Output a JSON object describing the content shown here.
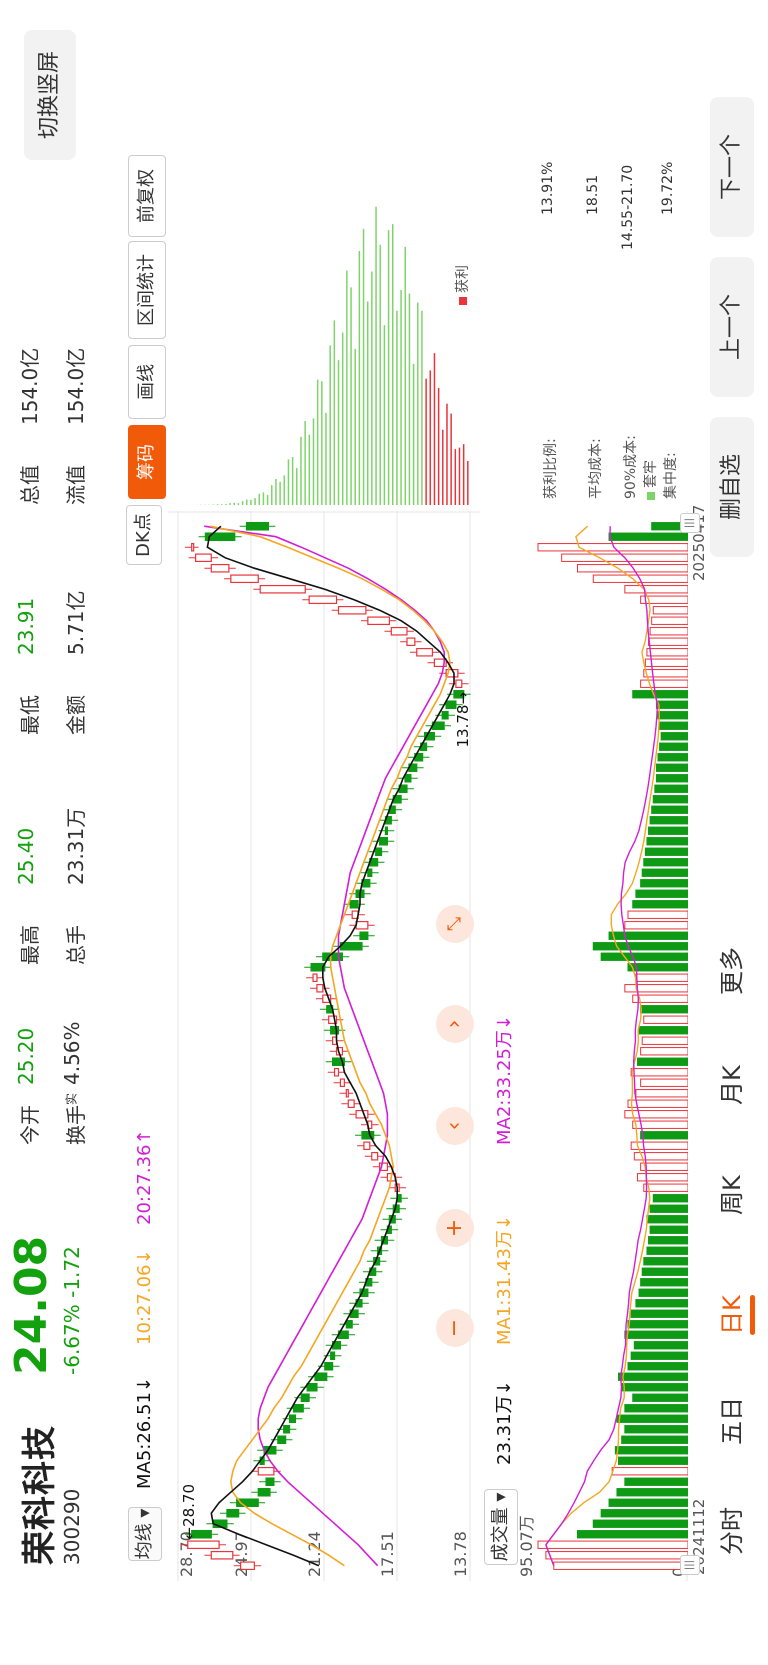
{
  "stock": {
    "name": "荣科科技",
    "code": "300290",
    "price": "24.08",
    "change": "-6.67%  -1.72"
  },
  "quote": [
    {
      "label": "今开",
      "value": "25.20",
      "green": true
    },
    {
      "label": "最高",
      "value": "25.40",
      "green": true
    },
    {
      "label": "最低",
      "value": "23.91",
      "green": true
    },
    {
      "label": "总值",
      "value": "154.0亿",
      "green": false
    },
    {
      "label": "换手",
      "value": "4.56%",
      "green": false
    },
    {
      "label": "总手",
      "value": "23.31万",
      "green": false
    },
    {
      "label": "金额",
      "value": "5.71亿",
      "green": false
    },
    {
      "label": "流值",
      "value": "154.0亿",
      "green": false
    }
  ],
  "turnover_sup": "实",
  "switch_label": "切换竖屏",
  "toolbar": {
    "ma_select": "均线",
    "ma5": "MA5:26.51↓",
    "ma10": "10:27.06↓",
    "ma20": "20:27.36↑",
    "dk": "DK点",
    "tabs": [
      "筹码",
      "画线",
      "区间统计",
      "前复权"
    ]
  },
  "volume": {
    "select": "成交量",
    "vol": "23.31万↓",
    "ma1": "MA1:31.43万↓",
    "ma2": "MA2:33.25万↓",
    "max_label": "95.07万",
    "zero_label": "0"
  },
  "dates": {
    "start": "20241112",
    "end": "20250417"
  },
  "price_axis": {
    "top": "28.70",
    "l2": "24.97",
    "l3": "21.24",
    "l4": "17.51",
    "bottom": "13.78"
  },
  "markers": {
    "high": "←28.70",
    "low": "13.78→"
  },
  "chips": {
    "legend_hold": "套牢",
    "legend_profit": "获利",
    "profit_ratio_label": "获利比例:",
    "profit_ratio": "13.91%",
    "avg_cost_label": "平均成本:",
    "avg_cost": "18.51",
    "cost90_label": "90%成本:",
    "cost90": "14.55-21.70",
    "concentration_label": "集中度:",
    "concentration": "19.72%"
  },
  "bottom_tabs": [
    "分时",
    "五日",
    "日K",
    "周K",
    "月K",
    "更多"
  ],
  "active_tab": 2,
  "nav": {
    "delete": "删自选",
    "prev": "上一个",
    "next": "下一个"
  },
  "colors": {
    "up": "#e8343a",
    "down": "#0e9a14",
    "ma5": "#111111",
    "ma10": "#f5a623",
    "ma20": "#d21ed7",
    "accent": "#f15a09",
    "price_green": "#13a10e"
  },
  "chart_data": {
    "type": "candlestick",
    "x_start": "20241112",
    "x_end": "20250417",
    "ylim": [
      13.78,
      28.7
    ],
    "close": [
      25.5,
      27.0,
      28.2,
      27.0,
      26.2,
      25.6,
      24.6,
      24.0,
      23.8,
      24.6,
      24.3,
      23.7,
      23.2,
      23.0,
      22.7,
      22.3,
      22.0,
      21.6,
      21.1,
      20.8,
      20.7,
      20.4,
      20.0,
      19.8,
      19.5,
      19.3,
      19.0,
      18.8,
      18.6,
      18.4,
      18.3,
      18.0,
      17.8,
      17.6,
      17.4,
      17.3,
      17.6,
      18.0,
      18.4,
      18.8,
      19.2,
      18.7,
      19.0,
      19.6,
      20.0,
      20.1,
      20.4,
      20.7,
      20.2,
      20.6,
      20.8,
      20.5,
      21.0,
      20.8,
      21.3,
      21.6,
      21.8,
      21.2,
      20.3,
      19.3,
      19.0,
      19.6,
      19.8,
      19.5,
      19.2,
      18.9,
      18.8,
      18.5,
      18.3,
      18.0,
      18.0,
      17.8,
      17.6,
      17.3,
      17.0,
      16.8,
      16.5,
      16.2,
      16.0,
      15.6,
      15.1,
      14.9,
      14.5,
      14.1,
      14.5,
      15.0,
      15.6,
      16.5,
      17.0,
      17.8,
      19.0,
      20.5,
      22.0,
      24.5,
      26.0,
      27.0,
      27.8,
      28.0,
      25.8,
      24.08
    ],
    "open": [
      24.8,
      25.9,
      26.6,
      28.0,
      26.9,
      26.2,
      25.7,
      24.6,
      24.2,
      23.8,
      24.5,
      24.3,
      23.6,
      23.3,
      23.0,
      22.8,
      22.4,
      22.1,
      21.7,
      21.2,
      20.9,
      20.8,
      20.5,
      20.1,
      19.9,
      19.6,
      19.4,
      19.1,
      18.9,
      18.7,
      18.5,
      18.3,
      18.0,
      17.9,
      17.7,
      17.5,
      17.4,
      17.6,
      18.0,
      18.5,
      18.9,
      19.3,
      18.8,
      19.0,
      19.7,
      20.1,
      20.2,
      20.5,
      20.8,
      20.3,
      20.6,
      20.9,
      20.6,
      21.1,
      20.9,
      21.3,
      21.6,
      21.9,
      21.3,
      20.4,
      19.4,
      19.0,
      19.5,
      19.9,
      19.6,
      19.3,
      19.0,
      18.9,
      18.6,
      18.4,
      18.1,
      18.1,
      17.9,
      17.7,
      17.4,
      17.1,
      16.9,
      16.6,
      16.3,
      16.1,
      15.7,
      15.2,
      15.0,
      14.6,
      14.2,
      14.4,
      15.0,
      15.7,
      16.6,
      17.0,
      17.9,
      19.1,
      20.6,
      22.2,
      24.6,
      26.1,
      27.0,
      28.0,
      27.3,
      25.2
    ],
    "ma5": [
      21.5,
      22.8,
      24.2,
      25.6,
      26.9,
      27.0,
      26.6,
      26.0,
      25.4,
      24.9,
      24.5,
      24.1,
      23.8,
      23.5,
      23.2,
      22.9,
      22.6,
      22.2,
      21.8,
      21.4,
      21.1,
      20.8,
      20.5,
      20.2,
      19.9,
      19.6,
      19.3,
      19.1,
      18.9,
      18.6,
      18.4,
      18.2,
      18.0,
      17.8,
      17.6,
      17.5,
      17.5,
      17.6,
      17.8,
      18.1,
      18.6,
      18.9,
      19.0,
      19.2,
      19.4,
      19.6,
      19.9,
      20.2,
      20.3,
      20.5,
      20.6,
      20.6,
      20.7,
      20.8,
      21.0,
      21.2,
      21.3,
      21.3,
      21.0,
      20.4,
      19.9,
      19.6,
      19.5,
      19.4,
      19.4,
      19.3,
      19.1,
      18.9,
      18.7,
      18.5,
      18.3,
      18.1,
      17.9,
      17.7,
      17.4,
      17.2,
      16.9,
      16.6,
      16.3,
      16.0,
      15.7,
      15.4,
      15.1,
      14.8,
      14.6,
      14.6,
      14.9,
      15.3,
      15.9,
      16.5,
      17.3,
      18.4,
      19.7,
      21.2,
      23.0,
      24.8,
      26.3,
      27.2,
      27.1,
      26.51
    ],
    "ma10": [
      20.2,
      21.0,
      21.9,
      22.9,
      23.9,
      24.8,
      25.5,
      25.9,
      26.0,
      25.9,
      25.7,
      25.3,
      24.9,
      24.5,
      24.1,
      23.8,
      23.4,
      23.1,
      22.8,
      22.4,
      22.1,
      21.8,
      21.5,
      21.2,
      20.9,
      20.6,
      20.3,
      20.0,
      19.7,
      19.4,
      19.2,
      18.9,
      18.7,
      18.5,
      18.3,
      18.1,
      17.9,
      17.8,
      17.7,
      17.8,
      17.9,
      18.1,
      18.3,
      18.6,
      18.9,
      19.1,
      19.4,
      19.6,
      19.8,
      20.0,
      20.2,
      20.3,
      20.4,
      20.5,
      20.6,
      20.7,
      20.8,
      20.9,
      20.9,
      20.8,
      20.6,
      20.4,
      20.2,
      20.0,
      19.8,
      19.6,
      19.4,
      19.2,
      19.0,
      18.8,
      18.6,
      18.4,
      18.2,
      18.0,
      17.8,
      17.5,
      17.3,
      17.0,
      16.8,
      16.5,
      16.2,
      15.9,
      15.6,
      15.3,
      15.1,
      14.9,
      14.8,
      14.9,
      15.2,
      15.6,
      16.1,
      16.7,
      17.4,
      18.3,
      19.3,
      20.5,
      21.8,
      23.1,
      24.5,
      27.06
    ],
    "ma20": [
      18.5,
      19.0,
      19.5,
      20.1,
      20.7,
      21.3,
      21.9,
      22.5,
      23.1,
      23.6,
      24.0,
      24.3,
      24.5,
      24.6,
      24.6,
      24.5,
      24.3,
      24.1,
      23.8,
      23.5,
      23.2,
      22.9,
      22.6,
      22.3,
      22.0,
      21.7,
      21.4,
      21.1,
      20.8,
      20.5,
      20.2,
      19.9,
      19.6,
      19.3,
      19.1,
      18.9,
      18.7,
      18.5,
      18.3,
      18.2,
      18.1,
      18.0,
      18.0,
      18.0,
      18.1,
      18.2,
      18.4,
      18.6,
      18.8,
      19.0,
      19.2,
      19.4,
      19.6,
      19.8,
      20.0,
      20.2,
      20.3,
      20.4,
      20.5,
      20.5,
      20.5,
      20.4,
      20.3,
      20.2,
      20.1,
      20.0,
      19.9,
      19.7,
      19.5,
      19.3,
      19.1,
      18.9,
      18.7,
      18.5,
      18.3,
      18.1,
      17.8,
      17.5,
      17.2,
      16.9,
      16.6,
      16.3,
      16.0,
      15.7,
      15.4,
      15.2,
      15.1,
      15.1,
      15.3,
      15.6,
      16.0,
      16.6,
      17.3,
      18.1,
      19.0,
      20.0,
      21.2,
      22.4,
      23.7,
      27.36
    ],
    "volume": [
      85,
      90,
      95,
      70,
      60,
      55,
      50,
      45,
      40,
      48,
      44,
      46,
      42,
      40,
      45,
      40,
      35,
      42,
      44,
      38,
      36,
      34,
      40,
      38,
      36,
      33,
      31,
      30,
      29,
      28,
      26,
      25,
      24,
      26,
      24,
      22,
      28,
      32,
      30,
      34,
      36,
      30,
      35,
      40,
      38,
      33,
      30,
      36,
      32,
      30,
      29,
      31,
      28,
      30,
      35,
      40,
      33,
      38,
      55,
      60,
      50,
      40,
      38,
      35,
      33,
      30,
      29,
      28,
      27,
      26,
      25,
      24,
      23,
      22,
      21,
      20,
      20,
      19,
      18,
      17,
      18,
      19,
      20,
      35,
      30,
      28,
      27,
      26,
      25,
      24,
      23,
      22,
      30,
      40,
      60,
      70,
      80,
      95,
      50,
      23
    ]
  }
}
